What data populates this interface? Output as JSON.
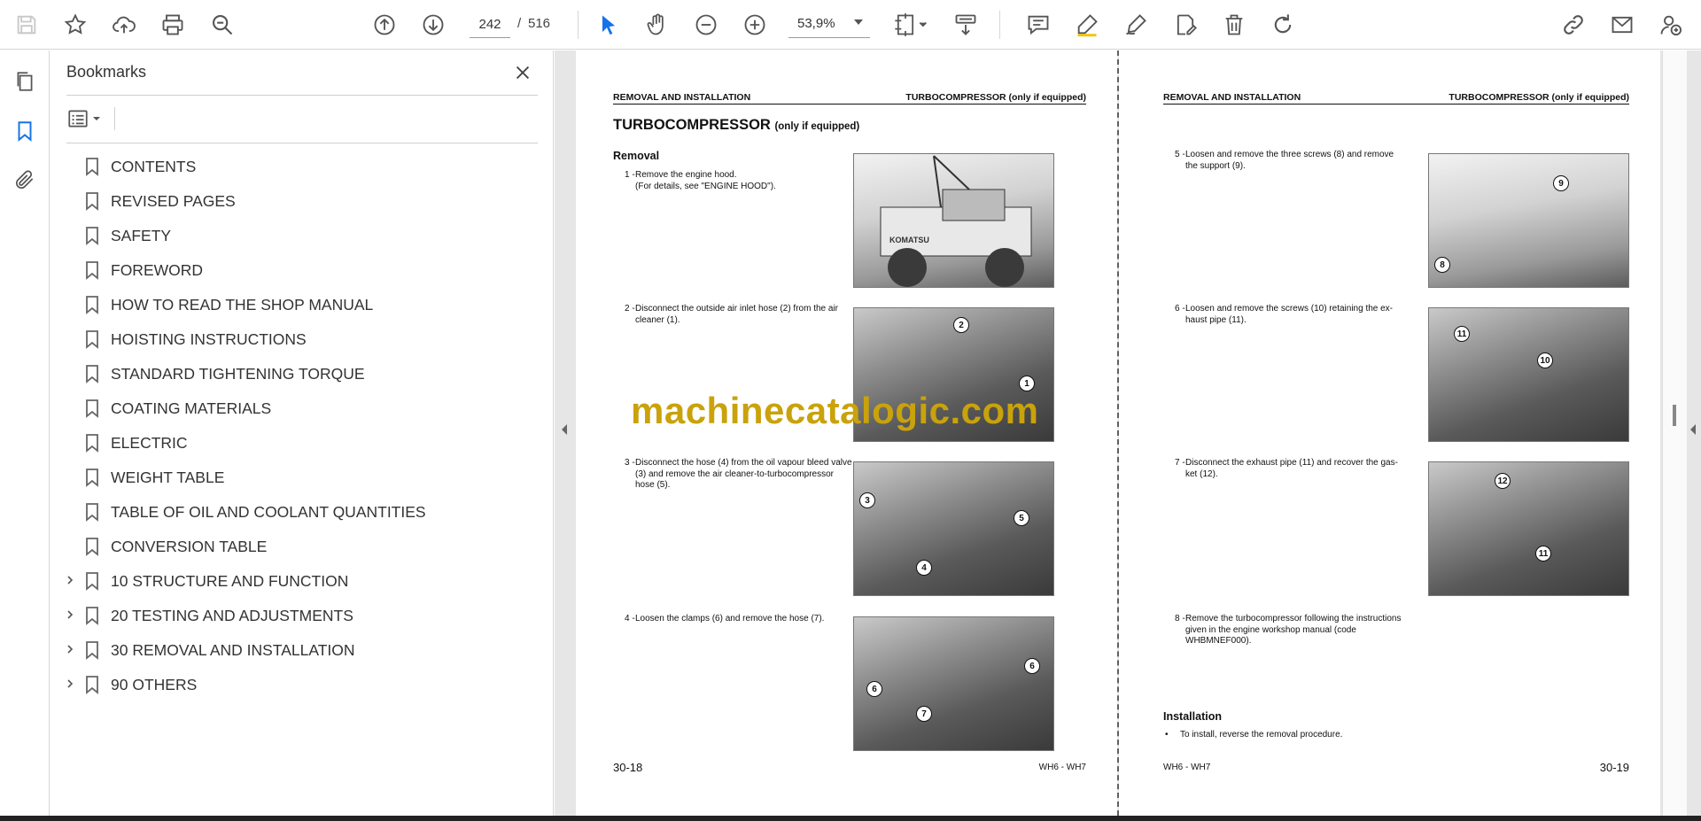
{
  "toolbar": {
    "current_page": "242",
    "page_separator": "/",
    "total_pages": "516",
    "zoom": "53,9%",
    "accent_color": "#1473e6"
  },
  "rail": {
    "icons": [
      "pages-thumbnail-icon",
      "bookmark-icon",
      "attachment-icon"
    ]
  },
  "bookmarks_panel": {
    "title": "Bookmarks",
    "items": [
      {
        "label": "CONTENTS",
        "expandable": false
      },
      {
        "label": "REVISED PAGES",
        "expandable": false
      },
      {
        "label": "SAFETY",
        "expandable": false
      },
      {
        "label": "FOREWORD",
        "expandable": false
      },
      {
        "label": "HOW TO READ THE SHOP MANUAL",
        "expandable": false
      },
      {
        "label": "HOISTING INSTRUCTIONS",
        "expandable": false
      },
      {
        "label": "STANDARD TIGHTENING TORQUE",
        "expandable": false
      },
      {
        "label": "COATING MATERIALS",
        "expandable": false
      },
      {
        "label": "ELECTRIC",
        "expandable": false
      },
      {
        "label": "WEIGHT TABLE",
        "expandable": false
      },
      {
        "label": "TABLE OF OIL AND COOLANT QUANTITIES",
        "expandable": false
      },
      {
        "label": "CONVERSION TABLE",
        "expandable": false
      },
      {
        "label": "10 STRUCTURE AND FUNCTION",
        "expandable": true
      },
      {
        "label": "20 TESTING AND ADJUSTMENTS",
        "expandable": true
      },
      {
        "label": "30 REMOVAL AND INSTALLATION",
        "expandable": true
      },
      {
        "label": "90 OTHERS",
        "expandable": true
      }
    ]
  },
  "left_page": {
    "header_left": "REMOVAL AND INSTALLATION",
    "header_right": "TURBOCOMPRESSOR (only if equipped)",
    "title": "TURBOCOMPRESSOR",
    "title_suffix": "(only if equipped)",
    "section": "Removal",
    "steps": [
      {
        "num": "1 -",
        "lines": [
          "Remove the engine hood.",
          "(For details, see \"ENGINE HOOD\")."
        ]
      },
      {
        "num": "2 -",
        "lines": [
          "Disconnect the outside air inlet hose (2) from the air",
          "cleaner (1)."
        ]
      },
      {
        "num": "3 -",
        "lines": [
          "Disconnect the hose (4) from the oil vapour bleed valve",
          "(3) and remove the air cleaner-to-turbocompressor",
          "hose (5)."
        ]
      },
      {
        "num": "4 -",
        "lines": [
          "Loosen the clamps (6) and remove the hose (7)."
        ]
      }
    ],
    "photo_callouts": [
      {
        "labels": []
      },
      {
        "labels": [
          "2",
          "1"
        ]
      },
      {
        "labels": [
          "3",
          "5",
          "4"
        ]
      },
      {
        "labels": [
          "6",
          "6",
          "7"
        ]
      }
    ],
    "photo_brand": "KOMATSU",
    "page_number": "30-18",
    "model": "WH6 - WH7"
  },
  "right_page": {
    "header_left": "REMOVAL AND INSTALLATION",
    "header_right": "TURBOCOMPRESSOR (only if equipped)",
    "steps": [
      {
        "num": "5 -",
        "lines": [
          "Loosen and remove the three screws (8) and remove",
          "the support (9)."
        ]
      },
      {
        "num": "6 -",
        "lines": [
          "Loosen and remove the screws (10) retaining the ex-",
          "haust pipe (11)."
        ]
      },
      {
        "num": "7 -",
        "lines": [
          "Disconnect the exhaust pipe (11) and recover the gas-",
          "ket (12)."
        ]
      },
      {
        "num": "8 -",
        "lines": [
          "Remove the turbocompressor following the instructions",
          "given in the engine workshop manual (code",
          "WHBMNEF000)."
        ]
      }
    ],
    "photo_callouts": [
      {
        "labels": [
          "9",
          "8"
        ]
      },
      {
        "labels": [
          "11",
          "10"
        ]
      },
      {
        "labels": [
          "12",
          "11"
        ]
      }
    ],
    "installation_title": "Installation",
    "installation_bullet": "•",
    "installation_text": "To install, reverse the removal procedure.",
    "page_number": "30-19",
    "model": "WH6 - WH7"
  },
  "watermark": "machinecatalogic.com"
}
